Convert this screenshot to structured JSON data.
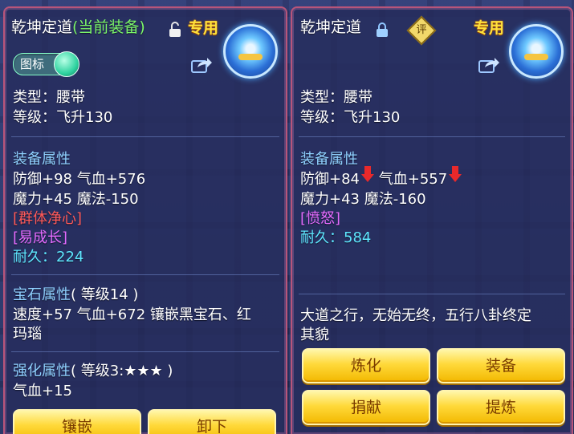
{
  "left_panel": {
    "item_name": "乾坤定道",
    "equipped_tag": "(当前装备)",
    "exclusive_label": "专用",
    "toggle_label": "图标",
    "type_line": "类型：腰带",
    "level_line": "等级：飞升130",
    "equip_attr_header": "装备属性",
    "attr_line_1": "防御+98 气血+576",
    "attr_line_2": "魔力+45 魔法-150",
    "special_1": "[群体净心]",
    "special_2": "[易成长]",
    "durability": "耐久：224",
    "gem_header": "宝石属性",
    "gem_level": "( 等级14 )",
    "gem_line_1": "速度+57 气血+672 镶嵌黑宝石、红",
    "gem_line_2": "玛瑙",
    "enhance_header": "强化属性",
    "enhance_level": "( 等级3:★★★ )",
    "enhance_line_1": "气血+15",
    "buttons": [
      "镶嵌",
      "卸下"
    ]
  },
  "right_panel": {
    "item_name": "乾坤定道",
    "badge_label": "评",
    "exclusive_label": "专用",
    "type_line": "类型：腰带",
    "level_line": "等级：飞升130",
    "equip_attr_header": "装备属性",
    "attr_defense": "防御+84",
    "attr_hp": "气血+557",
    "attr_line_2": "魔力+43 魔法-160",
    "special_1": "[愤怒]",
    "durability": "耐久：584",
    "description_1": "大道之行，无始无终，五行八卦终定",
    "description_2": "其貌",
    "buttons": [
      "炼化",
      "装备",
      "捐献",
      "提炼"
    ]
  },
  "colors": {
    "accent_yellow": "#ffd93a",
    "attr_blue": "#8fd0ff",
    "special_red": "#ff5a5a",
    "special_purple": "#e46bff",
    "durability_cyan": "#5ee7ff",
    "equipped_green": "#7bf56a"
  },
  "icons": {
    "left_lock": "unlocked-padlock-icon",
    "right_lock": "locked-padlock-icon",
    "share": "share-icon",
    "emblem": "belt-item-icon",
    "decrease": "red-down-arrow-icon"
  }
}
